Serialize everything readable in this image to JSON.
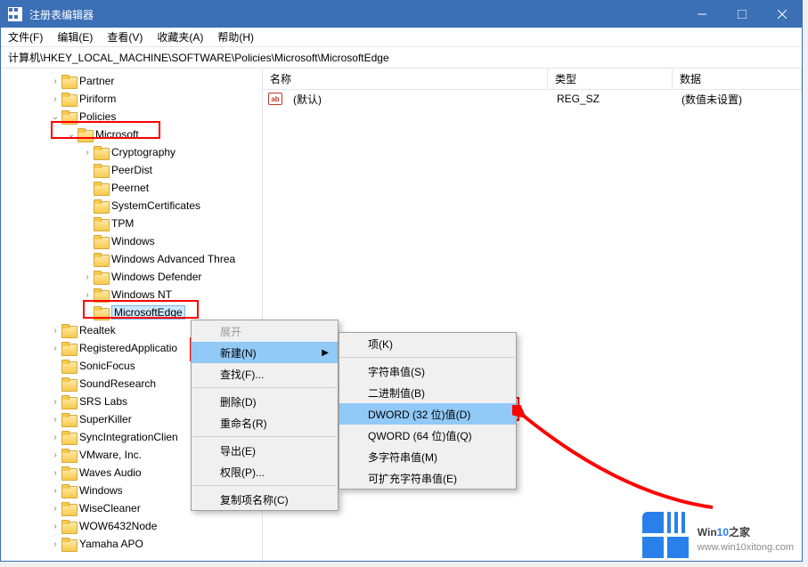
{
  "window": {
    "title": "注册表编辑器"
  },
  "menubar": [
    "文件(F)",
    "编辑(E)",
    "查看(V)",
    "收藏夹(A)",
    "帮助(H)"
  ],
  "addressbar": "计算机\\HKEY_LOCAL_MACHINE\\SOFTWARE\\Policies\\Microsoft\\MicrosoftEdge",
  "tree": [
    {
      "indent": 3,
      "chev": ">",
      "label": "Partner"
    },
    {
      "indent": 3,
      "chev": ">",
      "label": "Piriform"
    },
    {
      "indent": 3,
      "chev": "v",
      "label": "Policies"
    },
    {
      "indent": 4,
      "chev": "v",
      "label": "Microsoft",
      "highlight_box": true
    },
    {
      "indent": 5,
      "chev": ">",
      "label": "Cryptography"
    },
    {
      "indent": 5,
      "chev": "",
      "label": "PeerDist"
    },
    {
      "indent": 5,
      "chev": "",
      "label": "Peernet"
    },
    {
      "indent": 5,
      "chev": "",
      "label": "SystemCertificates"
    },
    {
      "indent": 5,
      "chev": "",
      "label": "TPM"
    },
    {
      "indent": 5,
      "chev": "",
      "label": "Windows"
    },
    {
      "indent": 5,
      "chev": "",
      "label": "Windows Advanced Threa"
    },
    {
      "indent": 5,
      "chev": ">",
      "label": "Windows Defender"
    },
    {
      "indent": 5,
      "chev": ">",
      "label": "Windows NT"
    },
    {
      "indent": 5,
      "chev": "",
      "label": "MicrosoftEdge",
      "selected": true,
      "highlight_box": true
    },
    {
      "indent": 3,
      "chev": ">",
      "label": "Realtek"
    },
    {
      "indent": 3,
      "chev": ">",
      "label": "RegisteredApplicatio"
    },
    {
      "indent": 3,
      "chev": "",
      "label": "SonicFocus"
    },
    {
      "indent": 3,
      "chev": "",
      "label": "SoundResearch"
    },
    {
      "indent": 3,
      "chev": ">",
      "label": "SRS Labs"
    },
    {
      "indent": 3,
      "chev": ">",
      "label": "SuperKiller"
    },
    {
      "indent": 3,
      "chev": ">",
      "label": "SyncIntegrationClien"
    },
    {
      "indent": 3,
      "chev": ">",
      "label": "VMware, Inc."
    },
    {
      "indent": 3,
      "chev": ">",
      "label": "Waves Audio"
    },
    {
      "indent": 3,
      "chev": ">",
      "label": "Windows"
    },
    {
      "indent": 3,
      "chev": ">",
      "label": "WiseCleaner"
    },
    {
      "indent": 3,
      "chev": ">",
      "label": "WOW6432Node"
    },
    {
      "indent": 3,
      "chev": ">",
      "label": "Yamaha APO"
    }
  ],
  "list": {
    "headers": {
      "name": "名称",
      "type": "类型",
      "data": "数据"
    },
    "rows": [
      {
        "icon": "ab",
        "name": "(默认)",
        "type": "REG_SZ",
        "data": "(数值未设置)"
      }
    ]
  },
  "context_menu1": [
    {
      "label": "展开",
      "type": "item",
      "disabled": true
    },
    {
      "label": "新建(N)",
      "type": "item",
      "highlight": true,
      "submenu": true
    },
    {
      "label": "查找(F)...",
      "type": "item"
    },
    {
      "type": "sep"
    },
    {
      "label": "删除(D)",
      "type": "item"
    },
    {
      "label": "重命名(R)",
      "type": "item"
    },
    {
      "type": "sep"
    },
    {
      "label": "导出(E)",
      "type": "item"
    },
    {
      "label": "权限(P)...",
      "type": "item"
    },
    {
      "type": "sep"
    },
    {
      "label": "复制项名称(C)",
      "type": "item"
    }
  ],
  "context_menu2": [
    {
      "label": "项(K)",
      "type": "item"
    },
    {
      "type": "sep"
    },
    {
      "label": "字符串值(S)",
      "type": "item"
    },
    {
      "label": "二进制值(B)",
      "type": "item"
    },
    {
      "label": "DWORD (32 位)值(D)",
      "type": "item",
      "highlight": true,
      "highlight_box": true
    },
    {
      "label": "QWORD (64 位)值(Q)",
      "type": "item"
    },
    {
      "label": "多字符串值(M)",
      "type": "item"
    },
    {
      "label": "可扩充字符串值(E)",
      "type": "item"
    }
  ],
  "watermark": {
    "brand1": "Win",
    "brand2": "10",
    "brand3": "之家",
    "url": "www.win10xitong.com"
  }
}
